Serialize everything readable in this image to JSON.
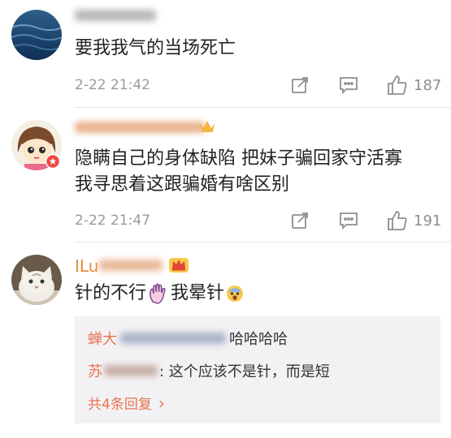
{
  "comments": [
    {
      "username": "",
      "text_lines": [
        "要我我气的当场死亡"
      ],
      "time": "2-22 21:42",
      "likes": "187"
    },
    {
      "username": "",
      "text_lines": [
        "隐瞒自己的身体缺陷 把妹子骗回家守活寡",
        "我寻思着这跟骗婚有啥区别"
      ],
      "time": "2-22 21:47",
      "likes": "191"
    },
    {
      "username_visible": "ILu",
      "text_a": "针的不行",
      "text_b": "我晕针",
      "replies": [
        {
          "name_visible": "蝉大",
          "text": "哈哈哈哈"
        },
        {
          "name_visible": "苏",
          "text": ": 这个应该不是针，而是短"
        }
      ],
      "more_replies": "共4条回复",
      "more_chevron": "›"
    }
  ],
  "colors": {
    "accent": "#eb7350",
    "name": "#e88a3c",
    "muted": "#9a9a9a"
  }
}
